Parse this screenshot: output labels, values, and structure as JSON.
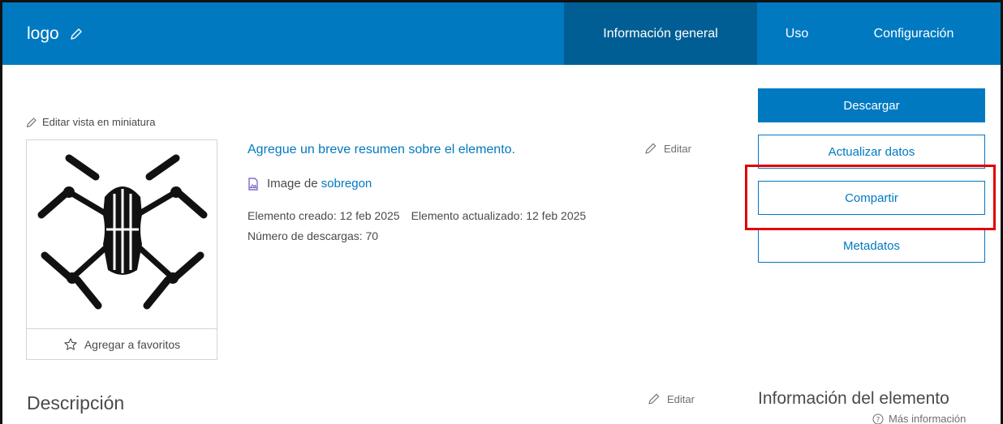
{
  "header": {
    "title": "logo",
    "tabs": [
      {
        "label": "Información general",
        "active": true
      },
      {
        "label": "Uso",
        "active": false
      },
      {
        "label": "Configuración",
        "active": false
      }
    ]
  },
  "thumbnail": {
    "edit_label": "Editar vista en miniatura",
    "favorite_label": "Agregar a favoritos"
  },
  "summary": {
    "text": "Agregue un breve resumen sobre el elemento.",
    "edit_label": "Editar",
    "type_prefix": "Image de",
    "owner": "sobregon",
    "created": "Elemento creado: 12 feb 2025",
    "updated": "Elemento actualizado: 12 feb 2025",
    "downloads": "Número de descargas: 70"
  },
  "actions": {
    "download": "Descargar",
    "update": "Actualizar datos",
    "share": "Compartir",
    "metadata": "Metadatos"
  },
  "description": {
    "heading": "Descripción",
    "edit_label": "Editar"
  },
  "item_info": {
    "heading": "Información del elemento",
    "more_info": "Más información"
  },
  "colors": {
    "brand_blue": "#0079c1",
    "active_tab": "#005e95",
    "highlight": "#e00000"
  }
}
